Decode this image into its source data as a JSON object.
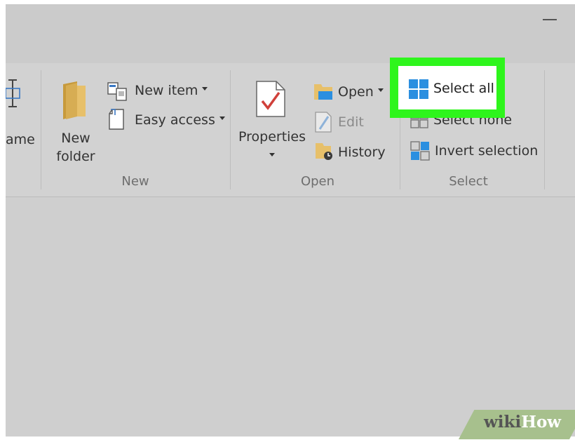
{
  "ribbon": {
    "rename_partial": "ame",
    "new_group": {
      "label": "New",
      "new_folder_line1": "New",
      "new_folder_line2": "folder",
      "new_item": "New item",
      "easy_access": "Easy access"
    },
    "open_group": {
      "label": "Open",
      "properties": "Properties",
      "open": "Open",
      "edit": "Edit",
      "history": "History"
    },
    "select_group": {
      "label": "Select",
      "select_all": "Select all",
      "select_none": "Select none",
      "invert_selection": "Invert selection"
    }
  },
  "watermark": {
    "wiki": "wiki",
    "how": "How"
  },
  "colors": {
    "highlight": "#2ef51c",
    "ribbon_bg": "#d2d2d2",
    "accent_blue": "#2b8fe0"
  }
}
